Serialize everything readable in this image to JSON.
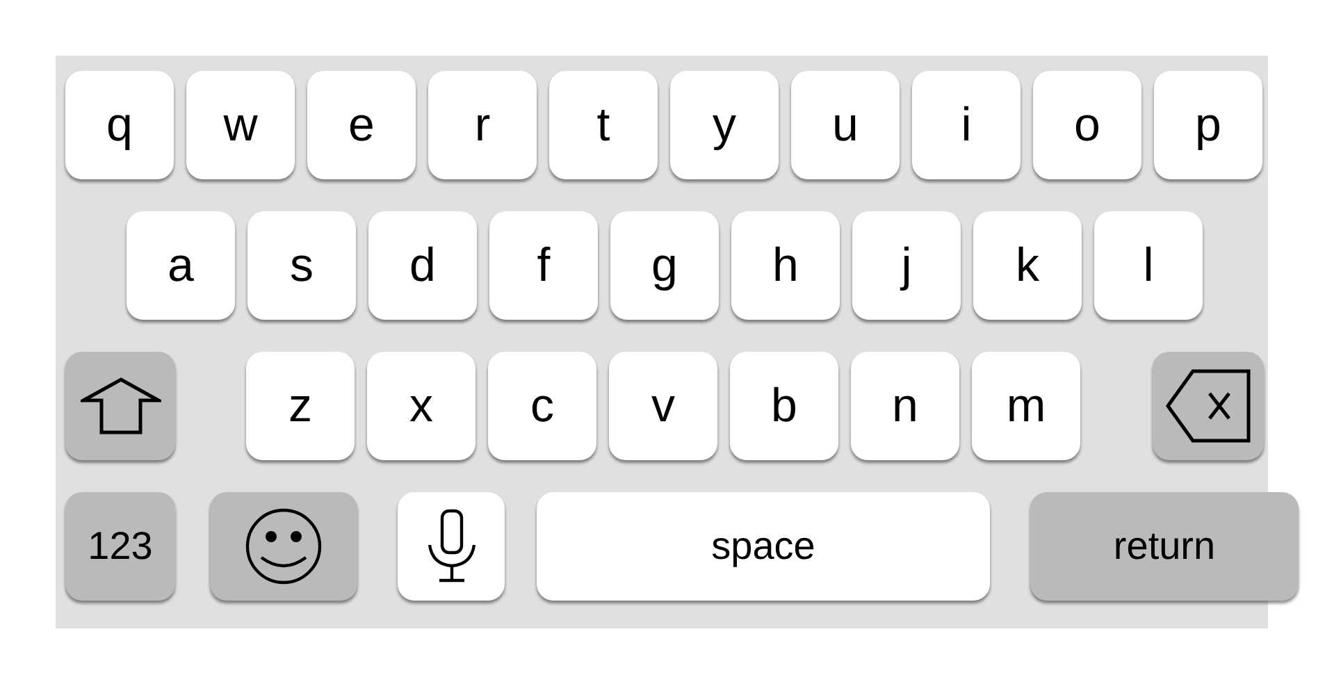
{
  "keyboard": {
    "rows": [
      {
        "keys": [
          {
            "kind": "letter",
            "label": "q"
          },
          {
            "kind": "letter",
            "label": "w"
          },
          {
            "kind": "letter",
            "label": "e"
          },
          {
            "kind": "letter",
            "label": "r"
          },
          {
            "kind": "letter",
            "label": "t"
          },
          {
            "kind": "letter",
            "label": "y"
          },
          {
            "kind": "letter",
            "label": "u"
          },
          {
            "kind": "letter",
            "label": "i"
          },
          {
            "kind": "letter",
            "label": "o"
          },
          {
            "kind": "letter",
            "label": "p"
          }
        ]
      },
      {
        "keys": [
          {
            "kind": "letter",
            "label": "a"
          },
          {
            "kind": "letter",
            "label": "s"
          },
          {
            "kind": "letter",
            "label": "d"
          },
          {
            "kind": "letter",
            "label": "f"
          },
          {
            "kind": "letter",
            "label": "g"
          },
          {
            "kind": "letter",
            "label": "h"
          },
          {
            "kind": "letter",
            "label": "j"
          },
          {
            "kind": "letter",
            "label": "k"
          },
          {
            "kind": "letter",
            "label": "l"
          }
        ]
      },
      {
        "keys": [
          {
            "kind": "shift"
          },
          {
            "kind": "letter",
            "label": "z"
          },
          {
            "kind": "letter",
            "label": "x"
          },
          {
            "kind": "letter",
            "label": "c"
          },
          {
            "kind": "letter",
            "label": "v"
          },
          {
            "kind": "letter",
            "label": "b"
          },
          {
            "kind": "letter",
            "label": "n"
          },
          {
            "kind": "letter",
            "label": "m"
          },
          {
            "kind": "delete"
          }
        ]
      },
      {
        "keys": [
          {
            "kind": "numbers",
            "label": "123"
          },
          {
            "kind": "emoji"
          },
          {
            "kind": "mic"
          },
          {
            "kind": "space",
            "label": "space"
          },
          {
            "kind": "return",
            "label": "return"
          }
        ]
      }
    ]
  }
}
